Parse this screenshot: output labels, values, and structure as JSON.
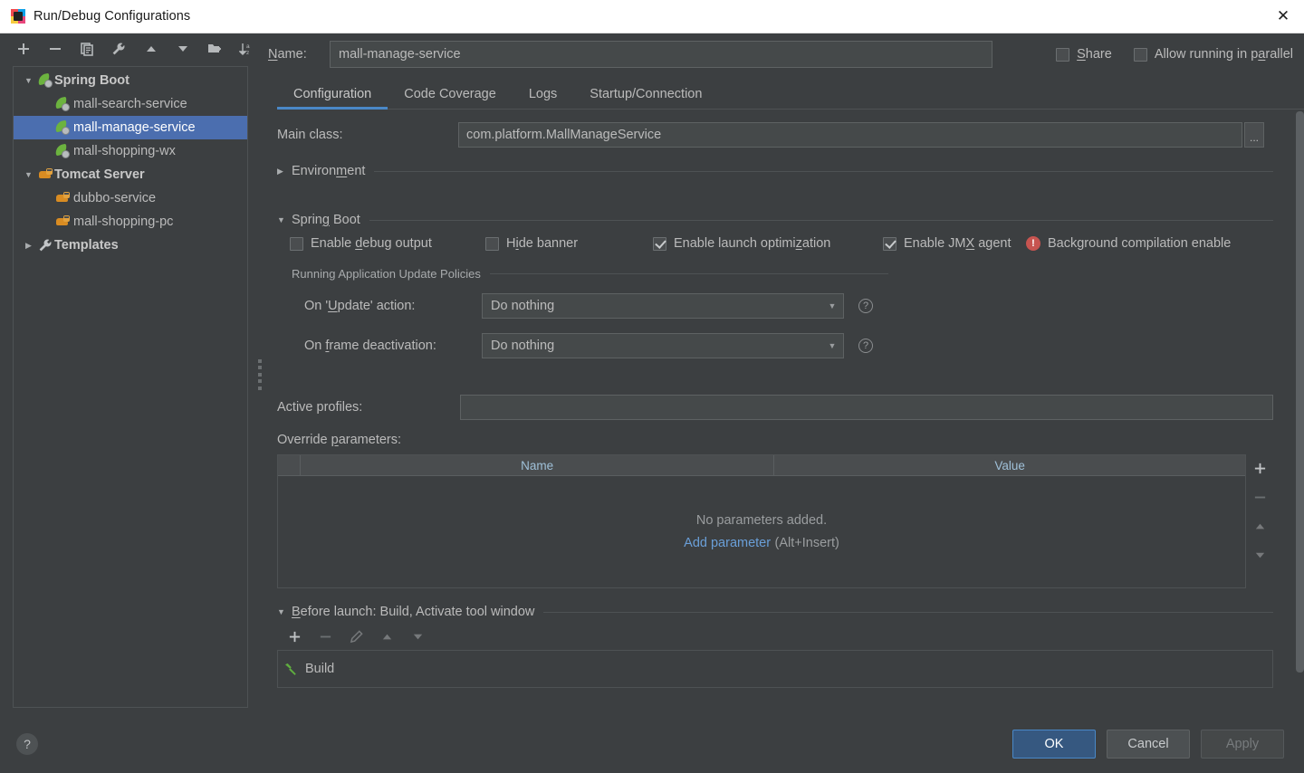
{
  "window": {
    "title": "Run/Debug Configurations",
    "close_label": "✕",
    "app_icon": "intellij-idea-icon"
  },
  "left_toolbar": {
    "buttons": [
      {
        "name": "add-configuration-button",
        "icon": "plus-icon",
        "label": "+"
      },
      {
        "name": "remove-configuration-button",
        "icon": "minus-icon",
        "label": "−"
      },
      {
        "name": "copy-configuration-button",
        "icon": "copy-icon",
        "label": "Copy"
      },
      {
        "name": "edit-templates-button",
        "icon": "wrench-icon",
        "label": "Edit Templates"
      },
      {
        "name": "move-up-button",
        "icon": "arrow-up-icon",
        "label": "Move Up"
      },
      {
        "name": "move-down-button",
        "icon": "arrow-down-icon",
        "label": "Move Down"
      },
      {
        "name": "new-folder-button",
        "icon": "folder-add-icon",
        "label": "New Folder"
      },
      {
        "name": "sort-configurations-button",
        "icon": "sort-az-icon",
        "label": "Sort Configurations"
      }
    ]
  },
  "tree": {
    "nodes": [
      {
        "label": "Spring Boot",
        "type": "group",
        "icon": "spring-boot-icon",
        "expanded": true,
        "selected": false
      },
      {
        "label": "mall-search-service",
        "type": "child",
        "icon": "spring-boot-icon",
        "expanded": null,
        "selected": false
      },
      {
        "label": "mall-manage-service",
        "type": "child",
        "icon": "spring-boot-icon",
        "expanded": null,
        "selected": true
      },
      {
        "label": "mall-shopping-wx",
        "type": "child",
        "icon": "spring-boot-icon",
        "expanded": null,
        "selected": false
      },
      {
        "label": "Tomcat Server",
        "type": "group",
        "icon": "tomcat-icon",
        "expanded": true,
        "selected": false
      },
      {
        "label": "dubbo-service",
        "type": "child",
        "icon": "tomcat-icon",
        "expanded": null,
        "selected": false
      },
      {
        "label": "mall-shopping-pc",
        "type": "child",
        "icon": "tomcat-icon",
        "expanded": null,
        "selected": false
      },
      {
        "label": "Templates",
        "type": "group",
        "icon": "wrench-icon",
        "expanded": false,
        "selected": false
      }
    ]
  },
  "name_row": {
    "label_prefix": "N",
    "label_rest": "ame:",
    "value": "mall-manage-service",
    "placeholder": "",
    "share": {
      "label_prefix": "S",
      "label_rest": "hare",
      "checked": false
    },
    "parallel": {
      "label_a": "Allow running in p",
      "label_mn": "a",
      "label_b": "rallel",
      "checked": false
    }
  },
  "tabs": [
    {
      "label": "Configuration",
      "active": true
    },
    {
      "label": "Code Coverage",
      "active": false
    },
    {
      "label": "Logs",
      "active": false
    },
    {
      "label": "Startup/Connection",
      "active": false
    }
  ],
  "main_class": {
    "label": "Main class:",
    "value": "com.platform.MallManageService",
    "browse_label": "..."
  },
  "environment_section": {
    "label_a": "Environ",
    "label_mn": "m",
    "label_b": "ent",
    "expanded": false,
    "arrow": "▶"
  },
  "spring_boot_section": {
    "label_a": "Sprin",
    "label_mn": "g",
    "label_b": " Boot",
    "expanded": true,
    "arrow": "▼",
    "checkboxes": [
      {
        "name": "enable-debug-output-checkbox",
        "pre": "Enable ",
        "mn": "d",
        "post": "ebug output",
        "checked": false
      },
      {
        "name": "hide-banner-checkbox",
        "pre": "H",
        "mn": "i",
        "post": "de banner",
        "checked": false
      },
      {
        "name": "enable-launch-optimization-checkbox",
        "pre": "Enable launch optimi",
        "mn": "z",
        "post": "ation",
        "checked": true
      },
      {
        "name": "enable-jmx-agent-checkbox",
        "pre": "Enable JM",
        "mn": "X",
        "post": " agent",
        "checked": true
      }
    ],
    "warning": {
      "icon": "error-circle-icon",
      "text": "Background compilation enable"
    }
  },
  "update_policies": {
    "group_label": "Running Application Update Policies",
    "on_update": {
      "label_a": "On '",
      "label_mn": "U",
      "label_b": "pdate' action:",
      "value": "Do nothing",
      "help": "?"
    },
    "on_frame_deactivation": {
      "label_a": "On ",
      "label_mn": "f",
      "label_b": "rame deactivation:",
      "value": "Do nothing",
      "help": "?"
    }
  },
  "active_profiles": {
    "label": "Active profiles:",
    "value": "",
    "placeholder": ""
  },
  "override_parameters": {
    "label_a": "Override ",
    "label_mn": "p",
    "label_b": "arameters:",
    "columns": [
      "",
      "Name",
      "Value"
    ],
    "rows": [],
    "empty_message": "No parameters added.",
    "empty_link": "Add parameter",
    "empty_hint": "(Alt+Insert)",
    "side_buttons": [
      {
        "name": "add-parameter-button",
        "icon": "plus-icon",
        "label": "+",
        "enabled": true
      },
      {
        "name": "remove-parameter-button",
        "icon": "minus-icon",
        "label": "−",
        "enabled": false
      },
      {
        "name": "move-parameter-up-button",
        "icon": "arrow-up-icon",
        "label": "▲",
        "enabled": false
      },
      {
        "name": "move-parameter-down-button",
        "icon": "arrow-down-icon",
        "label": "▼",
        "enabled": false
      }
    ]
  },
  "before_launch": {
    "arrow": "▼",
    "label_mn": "B",
    "label_rest": "efore launch: Build, Activate tool window",
    "toolbar": [
      {
        "name": "before-launch-add-button",
        "icon": "plus-icon",
        "label": "+",
        "enabled": true
      },
      {
        "name": "before-launch-remove-button",
        "icon": "minus-icon",
        "label": "−",
        "enabled": false
      },
      {
        "name": "before-launch-edit-button",
        "icon": "pencil-icon",
        "label": "✎",
        "enabled": false
      },
      {
        "name": "before-launch-up-button",
        "icon": "arrow-up-icon",
        "label": "▲",
        "enabled": false
      },
      {
        "name": "before-launch-down-button",
        "icon": "arrow-down-icon",
        "label": "▼",
        "enabled": false
      }
    ],
    "items": [
      {
        "label": "Build",
        "icon": "hammer-icon"
      }
    ]
  },
  "footer": {
    "help_label": "?",
    "ok_label": "OK",
    "cancel_label": "Cancel",
    "apply_label": "Apply"
  },
  "colors": {
    "accent": "#4a88c7",
    "selection": "#4b6eaf",
    "link": "#6a9fd8",
    "error": "#c75450",
    "spring_green": "#6cb33f",
    "tomcat_orange": "#d98c22",
    "background": "#3c3f41"
  }
}
